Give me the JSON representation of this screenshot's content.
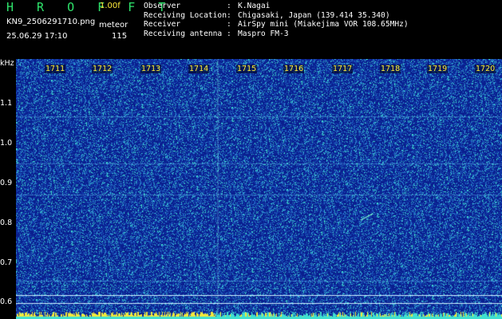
{
  "header": {
    "brand": "H R O F F T",
    "version": "1.00f",
    "filename": "KN9_2506291710.png",
    "meteor_label": "meteor",
    "timestamp": "25.06.29 17:10",
    "meteor_count": "115",
    "meta": [
      {
        "key": "Observer",
        "sep": ":",
        "value": "K.Nagai"
      },
      {
        "key": "Receiving Location",
        "sep": ":",
        "value": "Chigasaki, Japan (139.414 35.340)"
      },
      {
        "key": "Receiver",
        "sep": ":",
        "value": "AirSpy mini (Miakejima VOR 108.65MHz)"
      },
      {
        "key": "Receiving antenna",
        "sep": ":",
        "value": "Maspro FM-3"
      }
    ]
  },
  "axis": {
    "y_unit": "kHz",
    "y_ticks": [
      "1.1",
      "1.0",
      "0.9",
      "0.8",
      "0.7",
      "0.6"
    ],
    "x_ticks": [
      "1711",
      "1712",
      "1713",
      "1714",
      "1715",
      "1716",
      "1717",
      "1718",
      "1719",
      "1720"
    ]
  },
  "colors": {
    "background": "#0a1f8f",
    "noise": "#2f8bd6",
    "bright": "#3fe0d0",
    "strip_yellow": "#f4ea3a",
    "tick_label": "#ffeb3b"
  }
}
